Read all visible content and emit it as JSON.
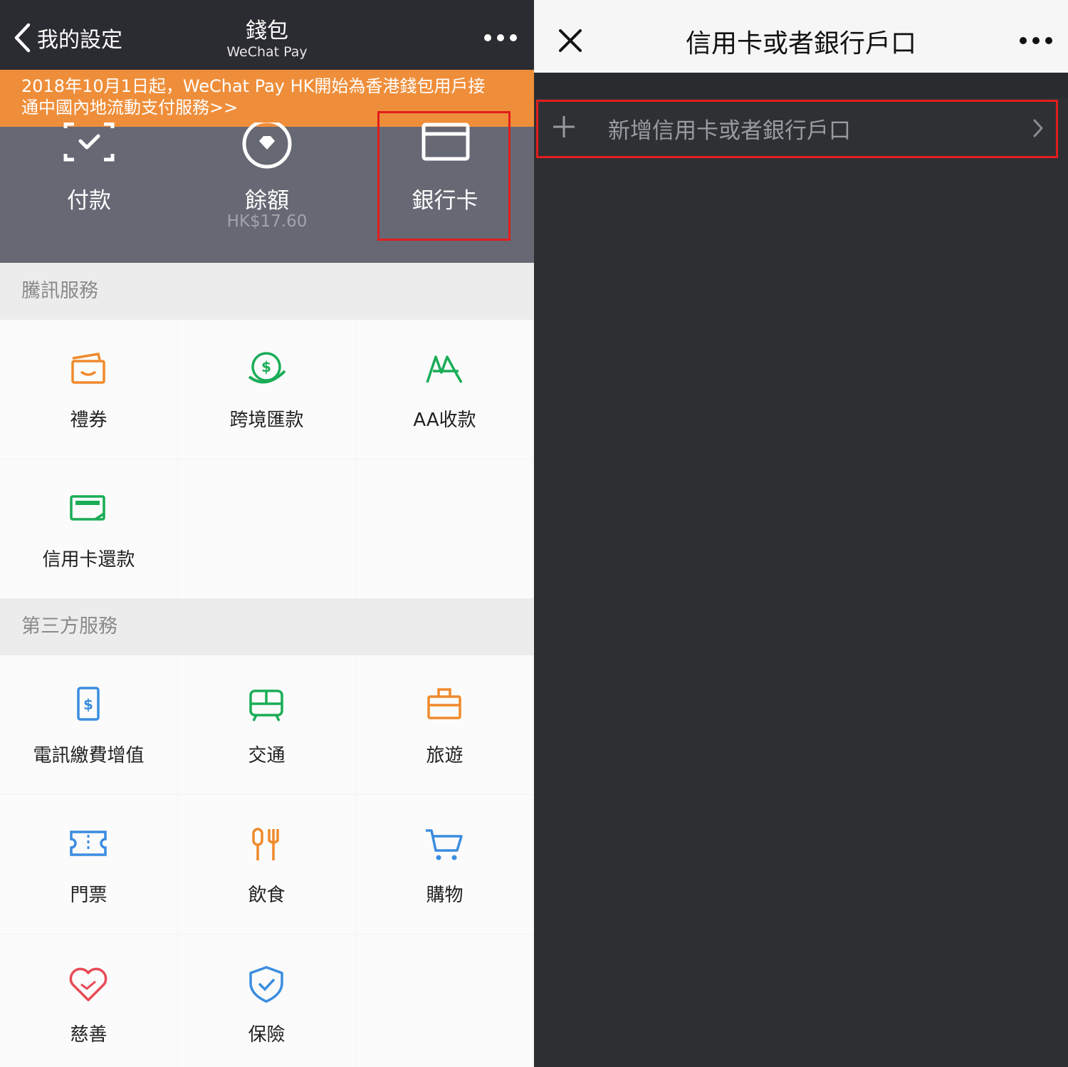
{
  "left": {
    "nav": {
      "back_label": "我的設定",
      "title": "錢包",
      "subtitle": "WeChat Pay"
    },
    "banner": {
      "line1": "2018年10月1日起，WeChat Pay HK開始為香港錢包用戶接",
      "line2": "通中國內地流動支付服務>>"
    },
    "hero": [
      {
        "label": "付款",
        "icon": "scan-pay-icon"
      },
      {
        "label": "餘額",
        "sub": "HK$17.60",
        "icon": "balance-diamond-icon"
      },
      {
        "label": "銀行卡",
        "icon": "bank-card-icon"
      }
    ],
    "tencent_section": {
      "title": "騰訊服務",
      "items": [
        {
          "label": "禮券",
          "icon": "gift-voucher-icon",
          "color": "#f08a2c"
        },
        {
          "label": "跨境匯款",
          "icon": "remittance-icon",
          "color": "#1aad57"
        },
        {
          "label": "AA收款",
          "icon": "aa-collect-icon",
          "color": "#1aad57"
        },
        {
          "label": "信用卡還款",
          "icon": "credit-card-repay-icon",
          "color": "#1aad57"
        }
      ]
    },
    "third_party_section": {
      "title": "第三方服務",
      "items": [
        {
          "label": "電訊繳費增值",
          "icon": "mobile-topup-icon",
          "color": "#3b8de0"
        },
        {
          "label": "交通",
          "icon": "transport-icon",
          "color": "#1aad57"
        },
        {
          "label": "旅遊",
          "icon": "travel-bag-icon",
          "color": "#f08a2c"
        },
        {
          "label": "門票",
          "icon": "ticket-icon",
          "color": "#3b8de0"
        },
        {
          "label": "飲食",
          "icon": "dining-icon",
          "color": "#f08a2c"
        },
        {
          "label": "購物",
          "icon": "shopping-cart-icon",
          "color": "#3b8de0"
        },
        {
          "label": "慈善",
          "icon": "charity-heart-icon",
          "color": "#e84a55"
        },
        {
          "label": "保險",
          "icon": "insurance-shield-icon",
          "color": "#3b8de0"
        }
      ]
    }
  },
  "right": {
    "title": "信用卡或者銀行戶口",
    "add_label": "新增信用卡或者銀行戶口"
  },
  "colors": {
    "nav_dark": "#2b2c31",
    "banner_orange": "#ef8e3a",
    "hero_gray": "#666874",
    "highlight_red": "#e21d1d",
    "right_bg": "#2e2f33"
  }
}
